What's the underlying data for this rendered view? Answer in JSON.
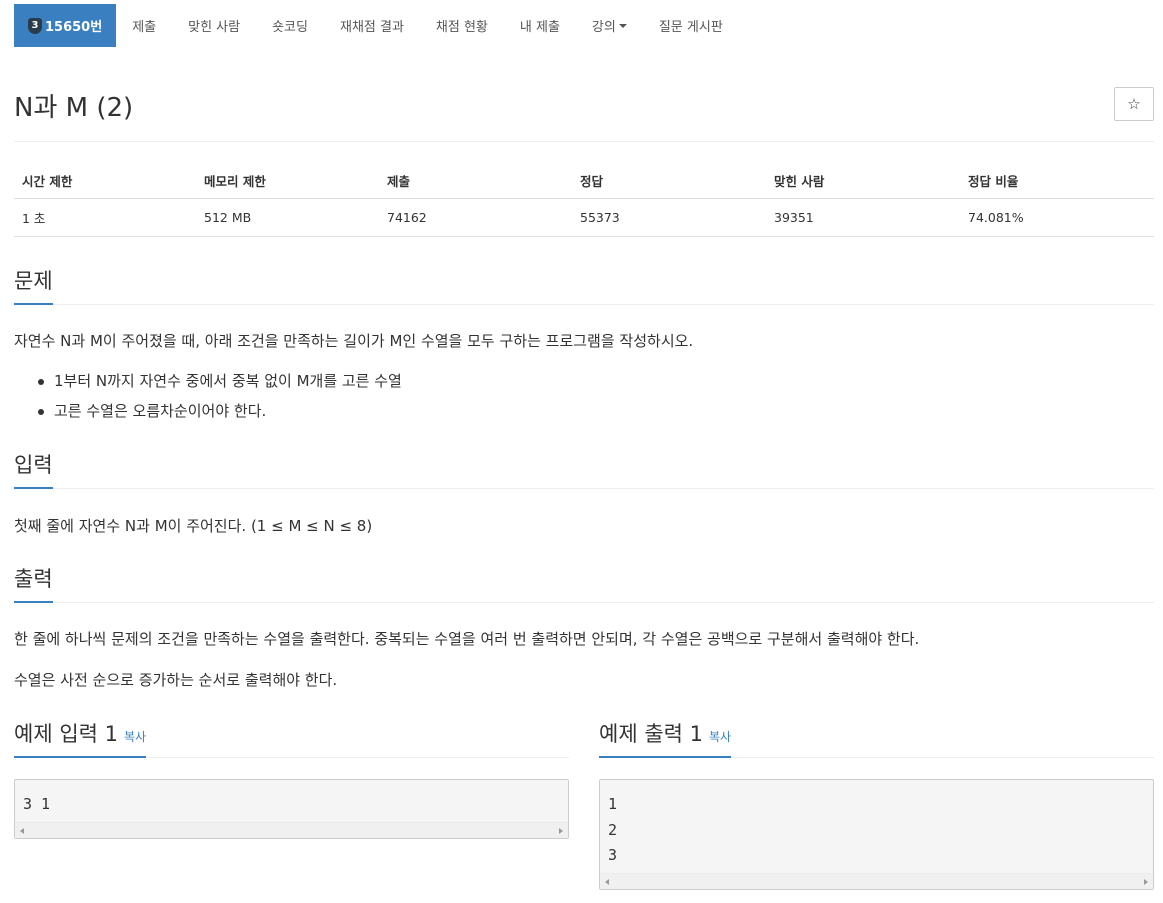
{
  "nav": {
    "tier_badge": "3",
    "problem_tab": "15650번",
    "tabs": [
      "제출",
      "맞힌 사람",
      "숏코딩",
      "재채점 결과",
      "채점 현황",
      "내 제출",
      "강의",
      "질문 게시판"
    ]
  },
  "problem": {
    "title": "N과 M (2)",
    "star_icon": "☆"
  },
  "info": {
    "headers": [
      "시간 제한",
      "메모리 제한",
      "제출",
      "정답",
      "맞힌 사람",
      "정답 비율"
    ],
    "values": [
      "1 초",
      "512 MB",
      "74162",
      "55373",
      "39351",
      "74.081%"
    ]
  },
  "sections": {
    "problem_head": "문제",
    "problem_text": "자연수 N과 M이 주어졌을 때, 아래 조건을 만족하는 길이가 M인 수열을 모두 구하는 프로그램을 작성하시오.",
    "conditions": [
      "1부터 N까지 자연수 중에서 중복 없이 M개를 고른 수열",
      "고른 수열은 오름차순이어야 한다."
    ],
    "input_head": "입력",
    "input_text": "첫째 줄에 자연수 N과 M이 주어진다. (1 ≤ M ≤ N ≤ 8)",
    "output_head": "출력",
    "output_text1": "한 줄에 하나씩 문제의 조건을 만족하는 수열을 출력한다. 중복되는 수열을 여러 번 출력하면 안되며, 각 수열은 공백으로 구분해서 출력해야 한다.",
    "output_text2": "수열은 사전 순으로 증가하는 순서로 출력해야 한다."
  },
  "examples": {
    "input_head": "예제 입력 1",
    "output_head": "예제 출력 1",
    "copy_label": "복사",
    "input_value": "3 1",
    "output_value": "1\n2\n3"
  },
  "colors": {
    "accent": "#3a80c1",
    "tier_badge": "#2a3b4c"
  }
}
